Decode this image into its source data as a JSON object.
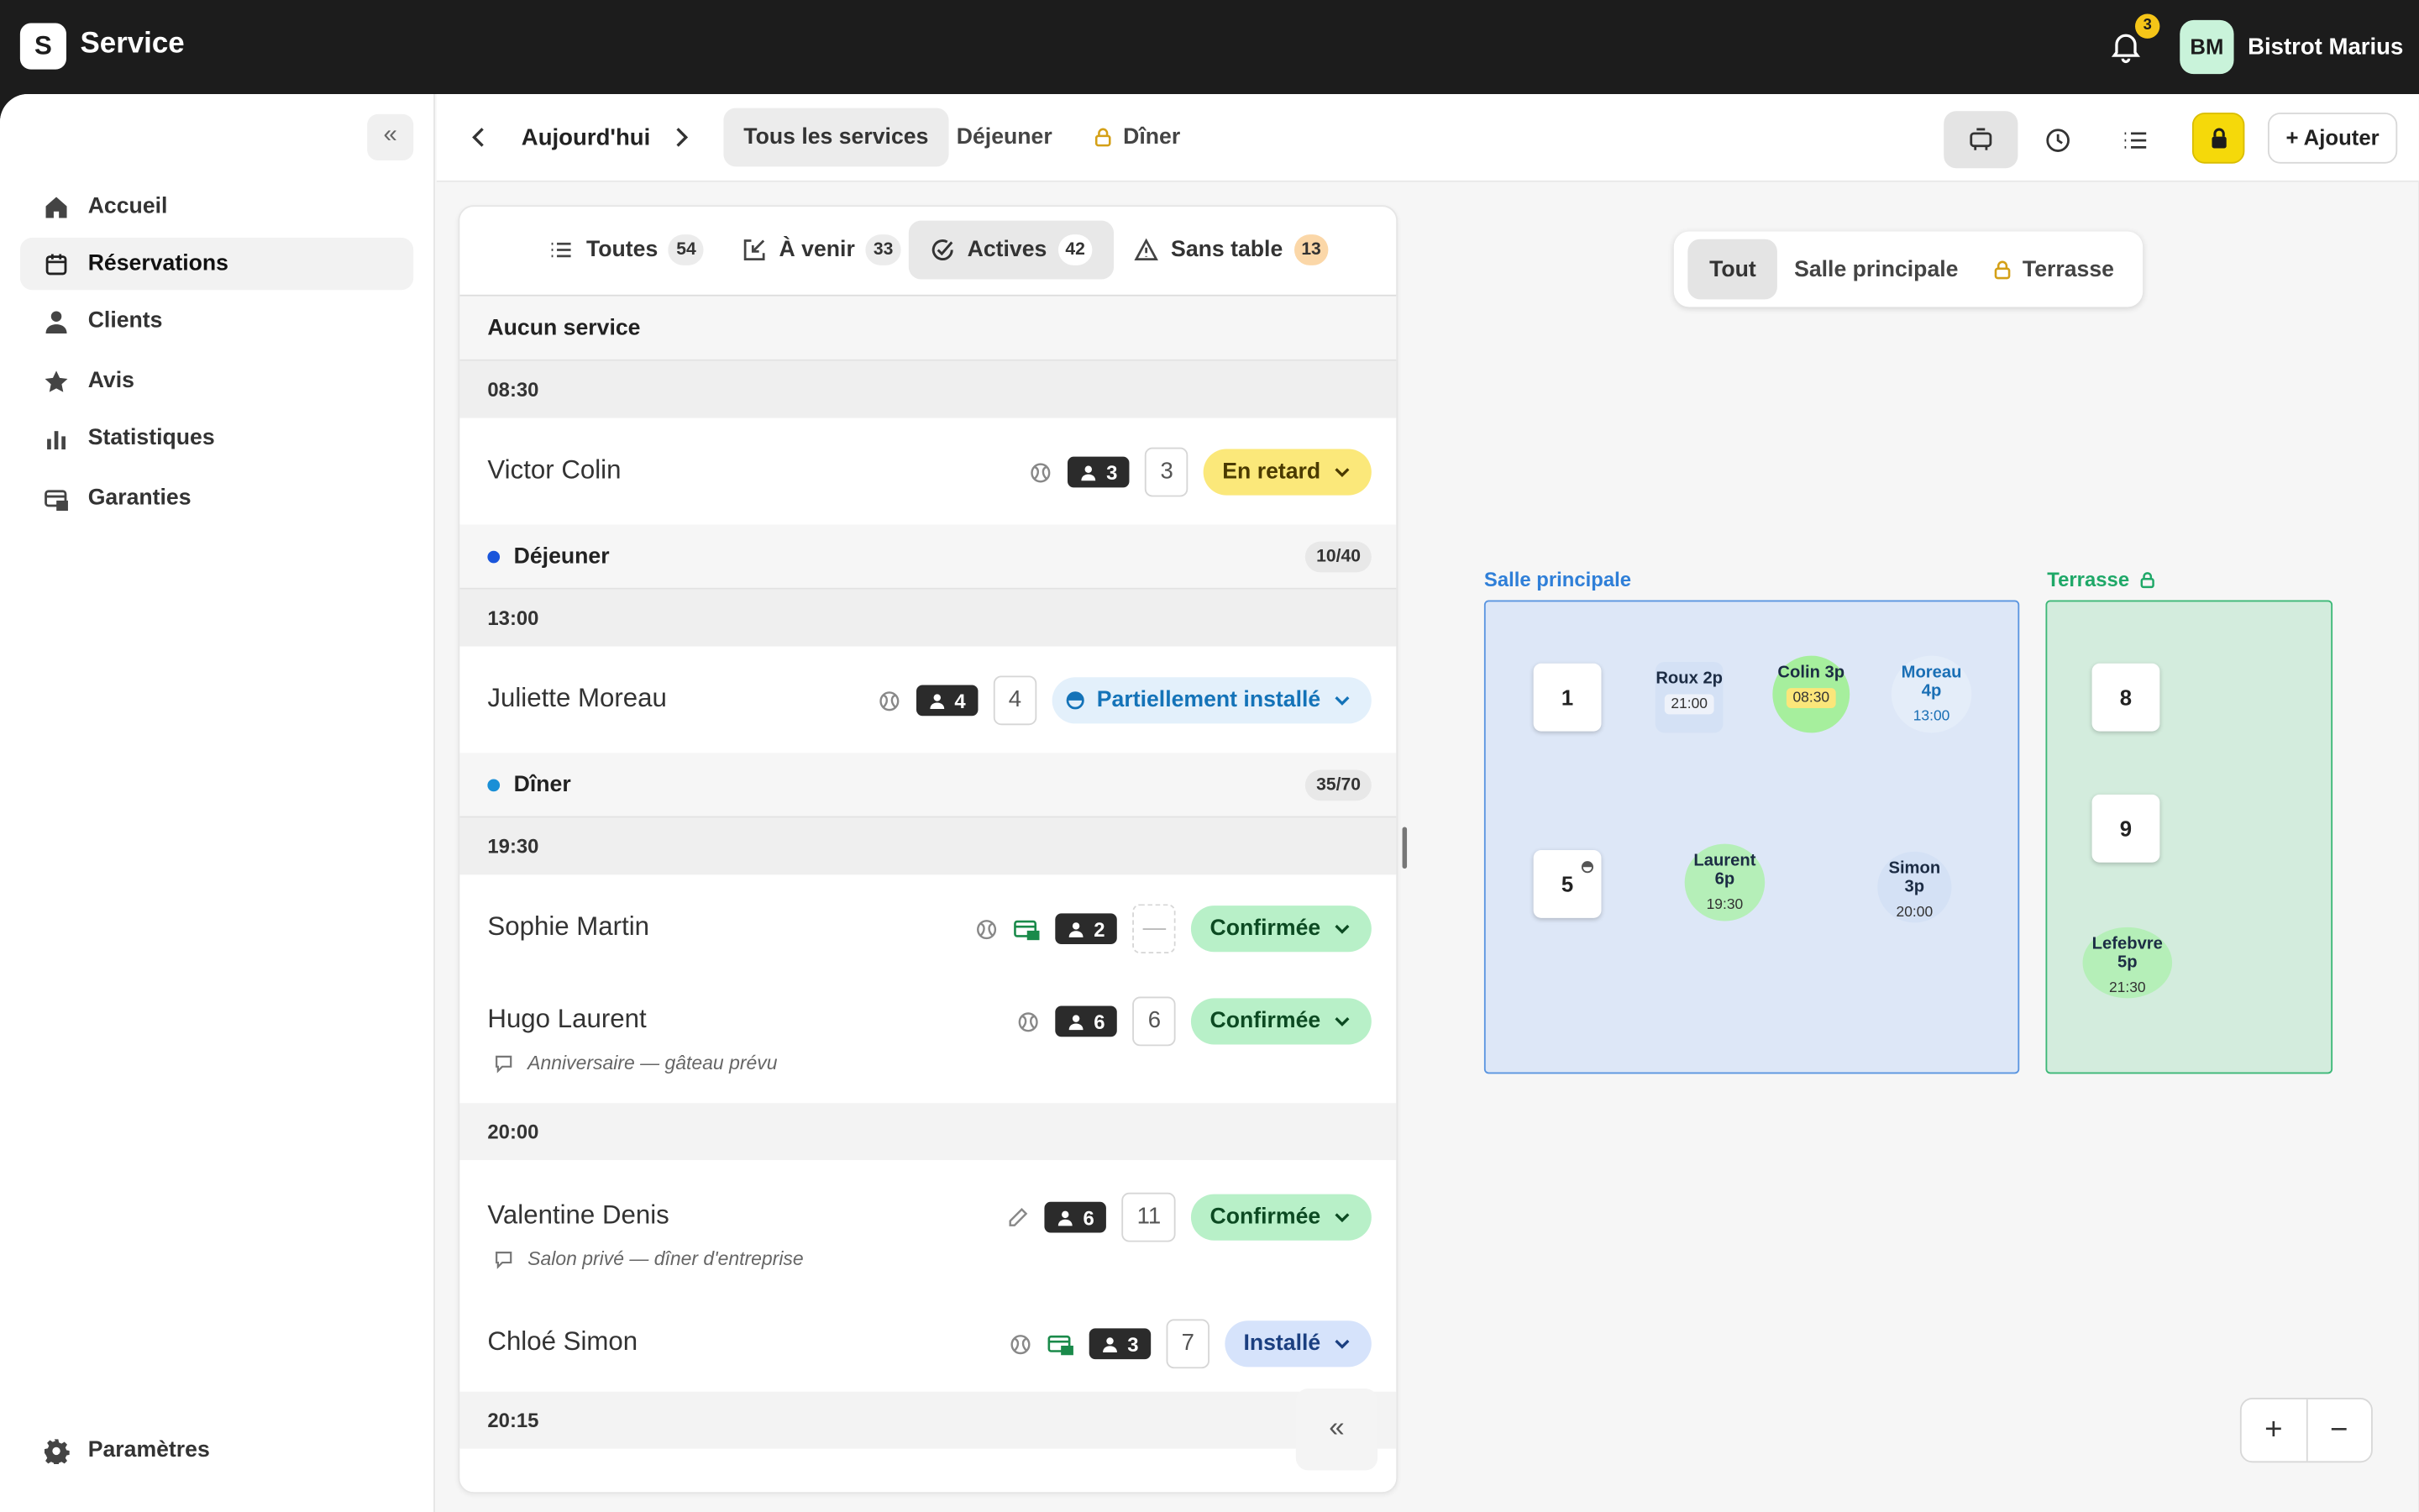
{
  "app": {
    "logo_letter": "S",
    "name": "Service"
  },
  "header": {
    "notifications": "3",
    "user_initials": "BM",
    "user_name": "Bistrot Marius"
  },
  "sidebar": {
    "collapse": "«",
    "items": [
      {
        "label": "Accueil",
        "icon": "home-icon"
      },
      {
        "label": "Réservations",
        "icon": "calendar-icon",
        "active": true
      },
      {
        "label": "Clients",
        "icon": "person-icon"
      },
      {
        "label": "Avis",
        "icon": "star-icon"
      },
      {
        "label": "Statistiques",
        "icon": "bar-chart-icon"
      },
      {
        "label": "Garanties",
        "icon": "card-lock-icon"
      }
    ],
    "settings": "Paramètres"
  },
  "toolbar": {
    "date": "Aujourd'hui",
    "services": [
      "Tous les services",
      "Déjeuner",
      "Dîner"
    ],
    "add": "+ Ajouter"
  },
  "filters": [
    {
      "label": "Toutes",
      "count": "54"
    },
    {
      "label": "À venir",
      "count": "33"
    },
    {
      "label": "Actives",
      "count": "42"
    },
    {
      "label": "Sans table",
      "count": "13"
    }
  ],
  "list": {
    "no_service": "Aucun service",
    "dejeuner": {
      "label": "Déjeuner",
      "capacity": "10/40",
      "color": "#1a56db"
    },
    "diner": {
      "label": "Dîner",
      "capacity": "35/70",
      "color": "#1a8fd6"
    },
    "times": [
      "08:30",
      "13:00",
      "19:30",
      "20:00",
      "20:15"
    ],
    "rows": [
      {
        "name": "Victor Colin",
        "pax": "3",
        "table": "3",
        "status": "En retard"
      },
      {
        "name": "Juliette Moreau",
        "pax": "4",
        "table": "4",
        "status": "Partiellement installé"
      },
      {
        "name": "Sophie Martin",
        "pax": "2",
        "table": "—",
        "status": "Confirmée"
      },
      {
        "name": "Hugo Laurent",
        "pax": "6",
        "table": "6",
        "status": "Confirmée",
        "note": "Anniversaire — gâteau prévu"
      },
      {
        "name": "Valentine Denis",
        "pax": "6",
        "table": "11",
        "status": "Confirmée",
        "note": "Salon privé — dîner d'entreprise"
      },
      {
        "name": "Chloé Simon",
        "pax": "3",
        "table": "7",
        "status": "Installé"
      }
    ],
    "collapse": "«"
  },
  "floor": {
    "tabs": [
      "Tout",
      "Salle principale",
      "Terrasse"
    ],
    "rooms": [
      {
        "name": "Salle principale",
        "color": "#2f7fd8"
      },
      {
        "name": "Terrasse",
        "color": "#1fa868"
      }
    ],
    "tables": [
      "1",
      "5",
      "8",
      "9"
    ],
    "reservations": [
      {
        "name": "Roux 2p",
        "time": "21:00"
      },
      {
        "name": "Colin 3p",
        "time": "08:30"
      },
      {
        "name": "Moreau 4p",
        "time": "13:00"
      },
      {
        "name": "Laurent 6p",
        "time": "19:30"
      },
      {
        "name": "Simon 3p",
        "time": "20:00"
      },
      {
        "name": "Lefebvre 5p",
        "time": "21:30"
      }
    ],
    "zoom_in": "+",
    "zoom_out": "−"
  }
}
